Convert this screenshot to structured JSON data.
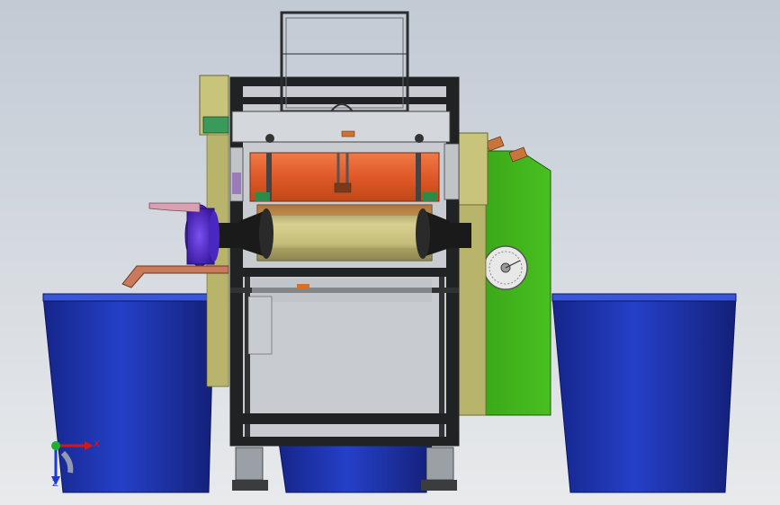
{
  "window": {
    "type": "cad-3d-viewport",
    "view": "front",
    "background_top": "#c2cad4",
    "background_bottom": "#e6e9ec"
  },
  "colors": {
    "bin_blue": "#1c32a8",
    "bin_rim": "#3850cc",
    "panel_green": "#3fb21c",
    "side_olive": "#c8c47c",
    "frame_dark": "#202224",
    "heater_red": "#e06030",
    "roller_olive": "#c0b870",
    "motor_purple": "#5a2ed0",
    "rubber_black": "#1a1a1a",
    "chute_copper": "#c87a5a"
  },
  "icons": {
    "triad": "coordinate-triad-icon",
    "dial": "dial-gauge-icon"
  },
  "axes": {
    "x_label": "X",
    "y_label": "Y",
    "z_label": "Z"
  }
}
